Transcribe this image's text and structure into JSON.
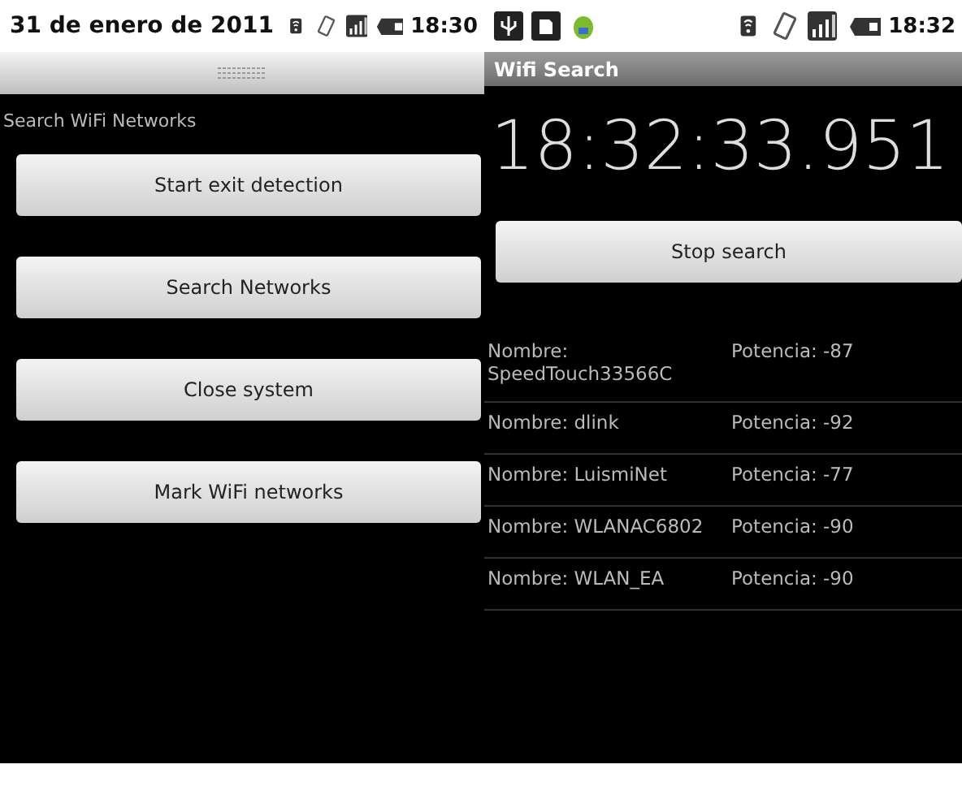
{
  "left": {
    "status_bar": {
      "date": "31 de enero de 2011",
      "time": "18:30"
    },
    "app_label": "Search WiFi Networks",
    "buttons": [
      "Start exit detection",
      "Search Networks",
      "Close system",
      "Mark WiFi networks"
    ]
  },
  "right": {
    "status_bar": {
      "time": "18:32"
    },
    "title": "Wifi Search",
    "clock": "18:32:33.951",
    "button": "Stop search",
    "networks": [
      {
        "name": "Nombre: SpeedTouch33566C",
        "power": "Potencia: -87"
      },
      {
        "name": "Nombre: dlink",
        "power": "Potencia: -92"
      },
      {
        "name": "Nombre: LuismiNet",
        "power": "Potencia: -77"
      },
      {
        "name": "Nombre: WLANAC6802",
        "power": "Potencia: -90"
      },
      {
        "name": "Nombre: WLAN_EA",
        "power": "Potencia: -90"
      }
    ]
  }
}
